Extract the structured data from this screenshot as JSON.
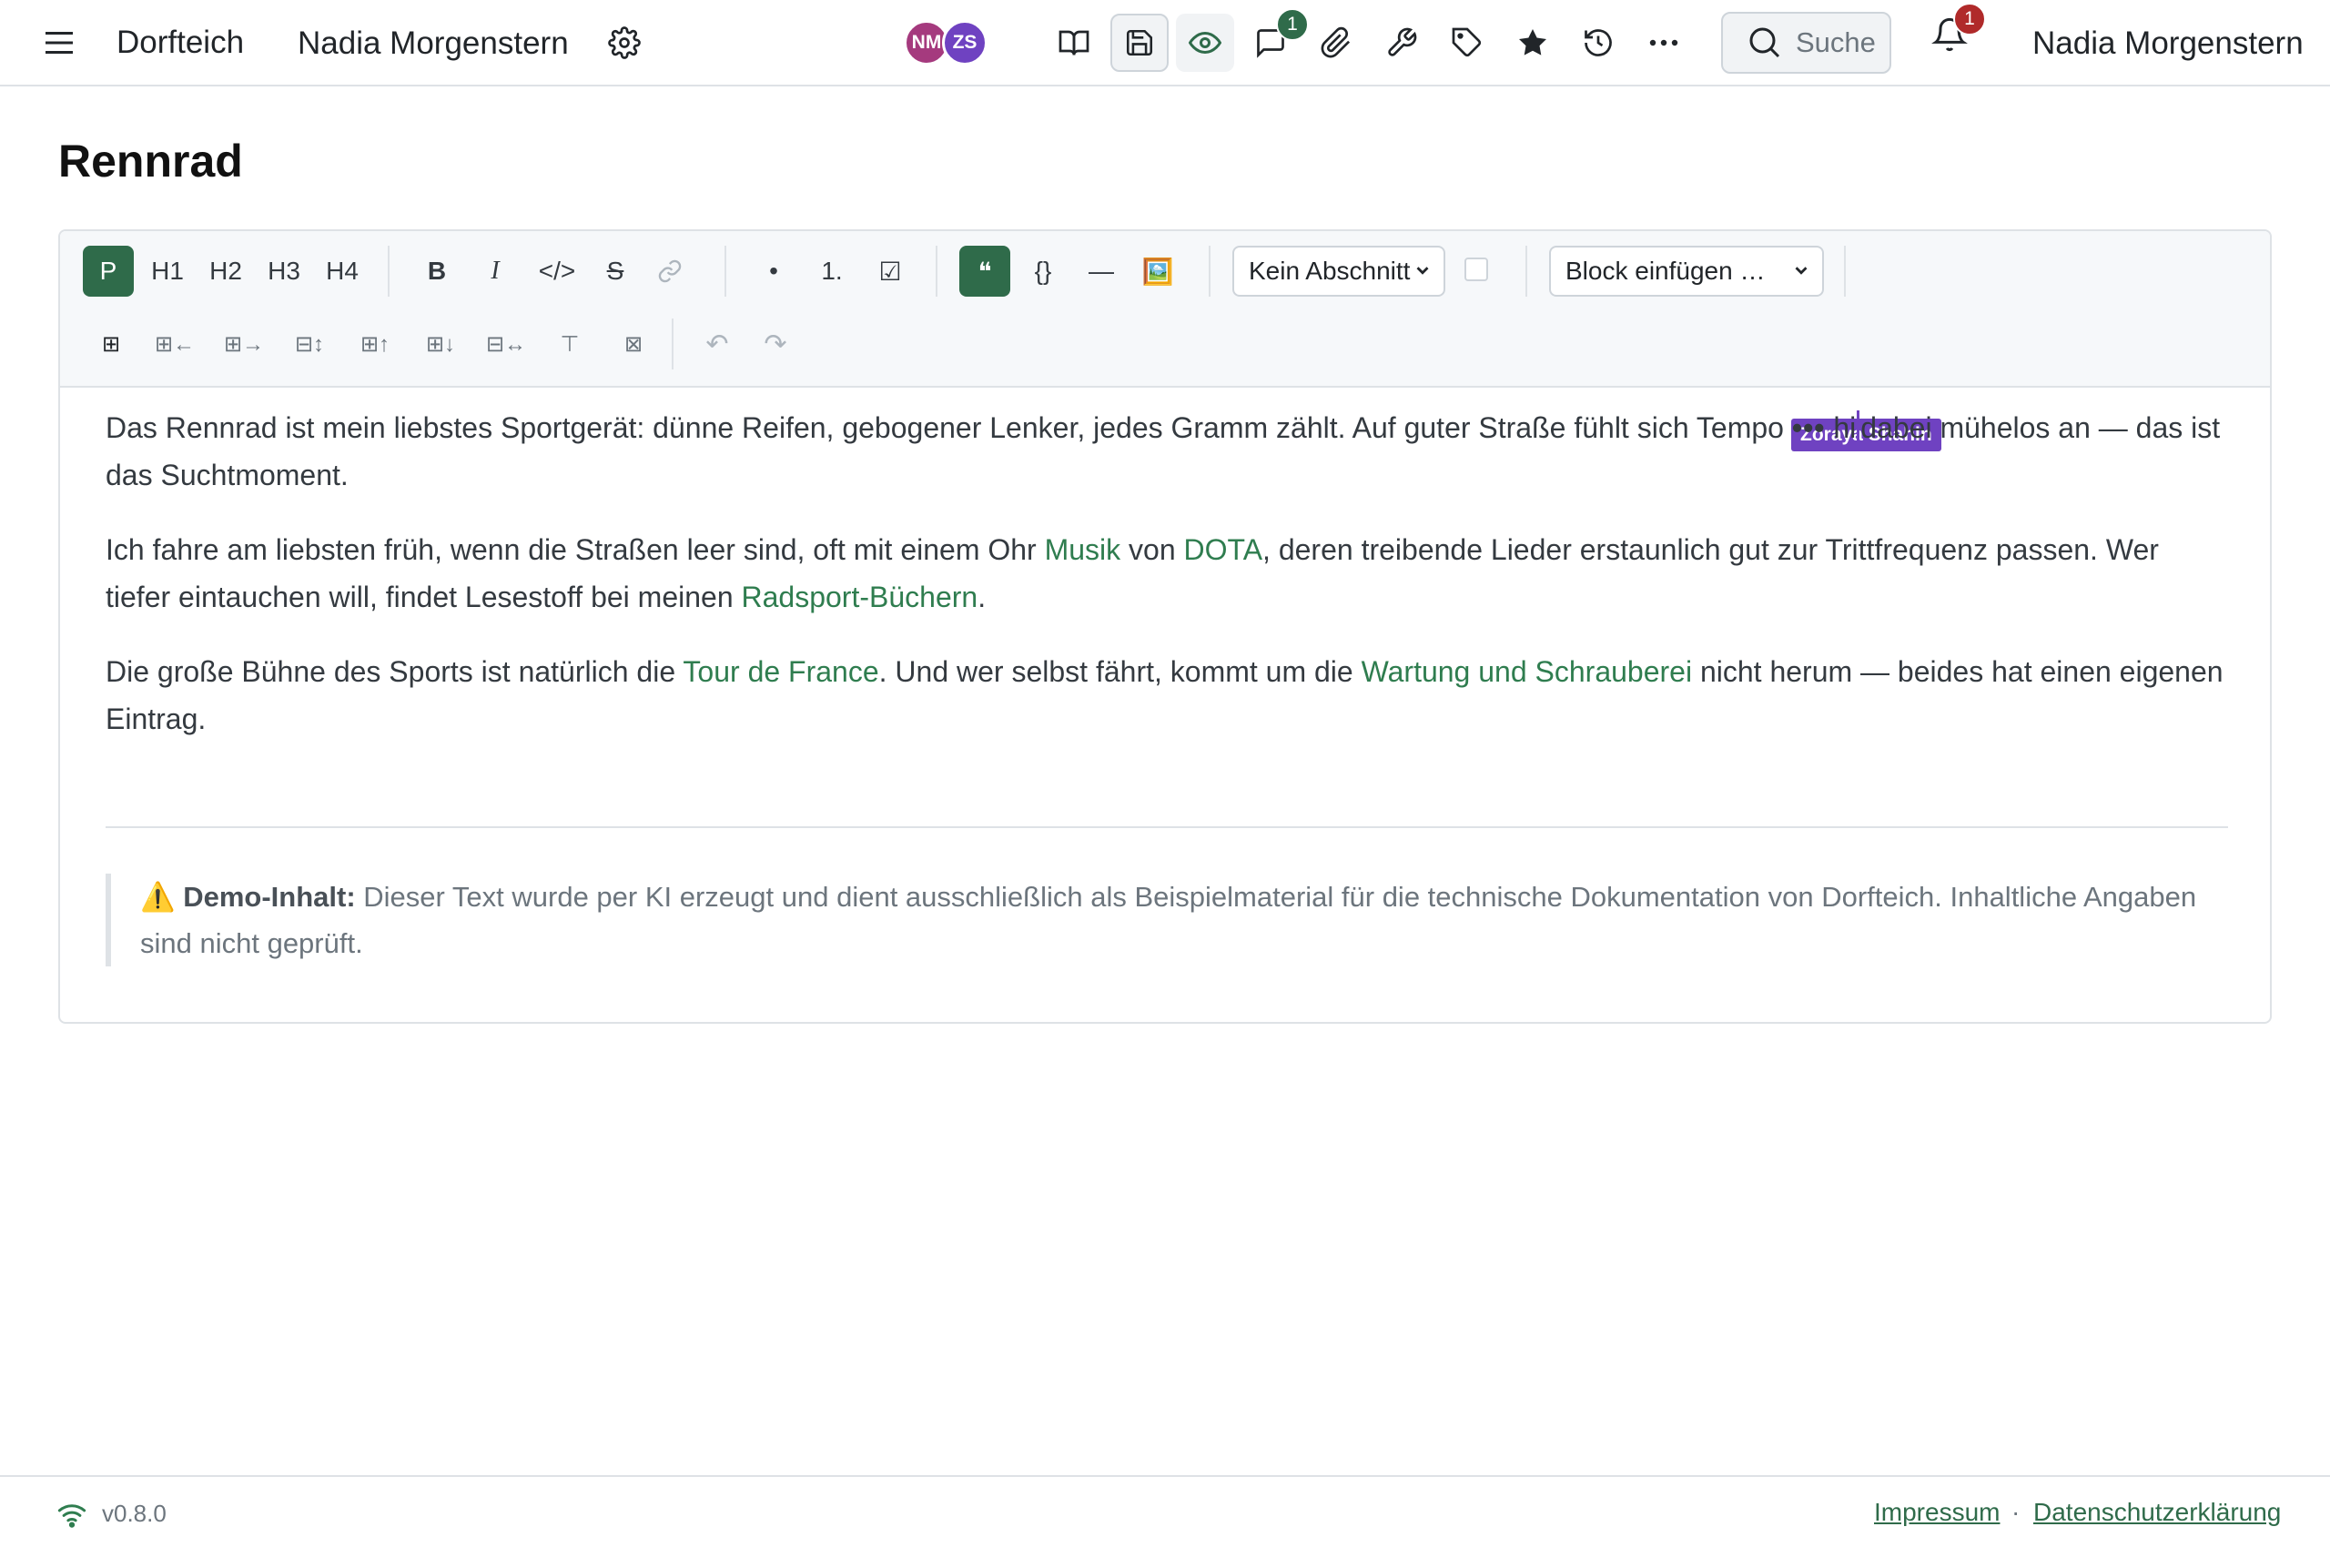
{
  "header": {
    "app_name": "Dorfteich",
    "workspace_name": "Nadia Morgenstern",
    "user_name": "Nadia Morgenstern",
    "search_label": "Suche",
    "comment_count": "1",
    "notification_count": "1",
    "avatars": [
      {
        "initials": "NM",
        "color": "#a53a7e"
      },
      {
        "initials": "ZS",
        "color": "#6f42c1"
      }
    ]
  },
  "page": {
    "title": "Rennrad"
  },
  "toolbar": {
    "paragraph": "P",
    "h1": "H1",
    "h2": "H2",
    "h3": "H3",
    "h4": "H4",
    "bold": "B",
    "italic": "I",
    "code": "</>",
    "strike": "S",
    "bullet_list": "•",
    "ordered_list": "1.",
    "task_list": "☑",
    "quote": "❝",
    "code_block": "{}",
    "horizontal_rule": "—",
    "image": "🖼️",
    "section_select": "Kein Abschnitt",
    "block_select": "Block einfügen …",
    "table_row_icons": [
      "⊞",
      "⊞←",
      "⊞→",
      "⊟↕",
      "⊞↑",
      "⊞↓",
      "⊟↔",
      "⊤",
      "⊠"
    ],
    "undo": "↶",
    "redo": "↷"
  },
  "content": {
    "remote_cursor_name": "Zoraya Shahin",
    "p1_a": "Das Rennrad ist mein liebstes Sportgerät: dünne Reifen, gebogener Lenker, jedes Gramm zählt. Auf guter Straße fühlt sich Tempo ",
    "p1_ellipsis": "•••",
    "p1_b": " hi",
    "p1_c": "dabei mühelos an — das ist das Suchtmoment.",
    "p2_a": "Ich fahre am liebsten früh, wenn die Straßen leer sind, oft mit einem Ohr ",
    "p2_link1": "Musik",
    "p2_b": " von ",
    "p2_link2": "DOTA",
    "p2_c": ", deren treibende Lieder erstaunlich gut zur Trittfrequenz passen. Wer tiefer eintauchen will, findet Lesestoff bei meinen ",
    "p2_link3": "Radsport-Büchern",
    "p2_d": ".",
    "p3_a": "Die große Bühne des Sports ist natürlich die ",
    "p3_link1": "Tour de France",
    "p3_b": ". Und wer selbst fährt, kommt um die ",
    "p3_link2": "Wartung und Schrauberei",
    "p3_c": " nicht herum — beides hat einen eigenen Eintrag.",
    "note_icon": "⚠️",
    "note_label": "Demo-Inhalt:",
    "note_text": " Dieser Text wurde per KI erzeugt und dient ausschließlich als Beispielmaterial für die technische Dokumentation von Dorfteich. Inhaltliche Angaben sind nicht geprüft."
  },
  "footer": {
    "version": "v0.8.0",
    "imprint": "Impressum",
    "separator": "·",
    "privacy": "Datenschutzerklärung"
  },
  "colors": {
    "accent": "#2f6b4a",
    "link": "#2f7d4f",
    "badge": "#b02a2a",
    "remote_cursor": "#6f42c1"
  }
}
